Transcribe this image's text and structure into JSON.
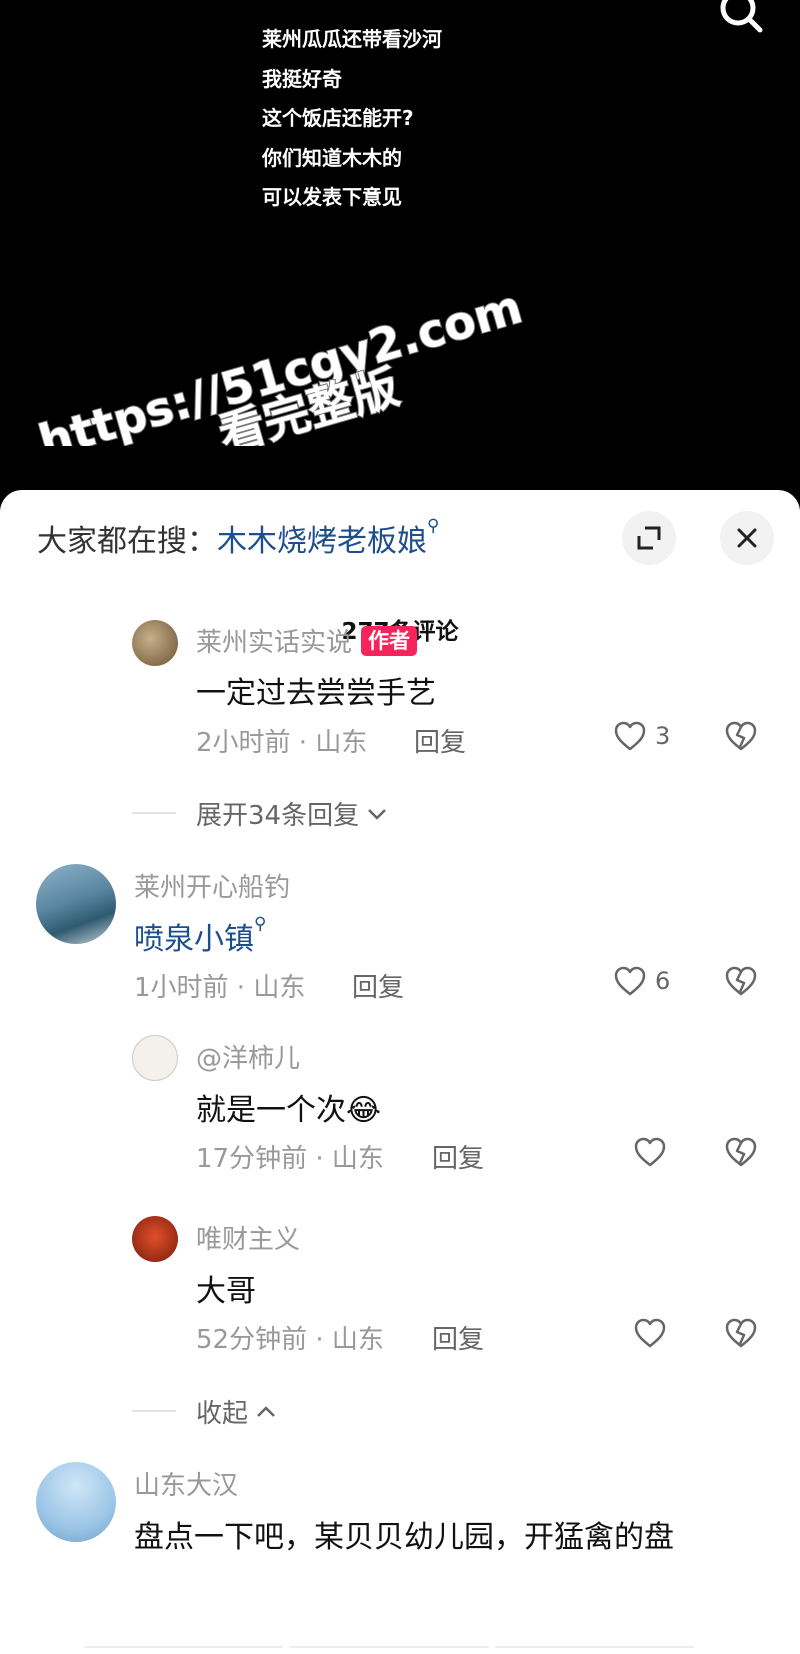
{
  "video": {
    "caption_lines": [
      "莱州瓜瓜还带看沙河",
      "我挺好奇",
      "这个饭店还能开?",
      "你们知道木木的",
      "可以发表下意见"
    ],
    "watermark_line1": "https://51cgy2.com",
    "watermark_line2": "看完整版"
  },
  "header": {
    "trending_label": "大家都在搜：",
    "trending_keyword": "木木烧烤老板娘",
    "comment_count": "277条评论"
  },
  "comments": [
    {
      "user": "莱州实话实说",
      "badge": "作者",
      "text": "一定过去尝尝手艺",
      "time_loc": "2小时前 · 山东",
      "reply_label": "回复",
      "likes": "3",
      "expand_label": "展开34条回复"
    },
    {
      "user": "莱州开心船钓",
      "text": "喷泉小镇",
      "time_loc": "1小时前 · 山东",
      "reply_label": "回复",
      "likes": "6",
      "replies": [
        {
          "user": "@洋柿儿",
          "text": "就是一个次",
          "emoji": "😂",
          "time_loc": "17分钟前 · 山东",
          "reply_label": "回复"
        },
        {
          "user": "唯财主义",
          "text": "大哥",
          "time_loc": "52分钟前 · 山东",
          "reply_label": "回复"
        }
      ],
      "collapse_label": "收起"
    },
    {
      "user": "山东大汉",
      "text": "盘点一下吧，某贝贝幼儿园，开猛禽的盘"
    }
  ],
  "colors": {
    "accent_link": "#1c4f8c",
    "author_badge": "#f5245a"
  }
}
